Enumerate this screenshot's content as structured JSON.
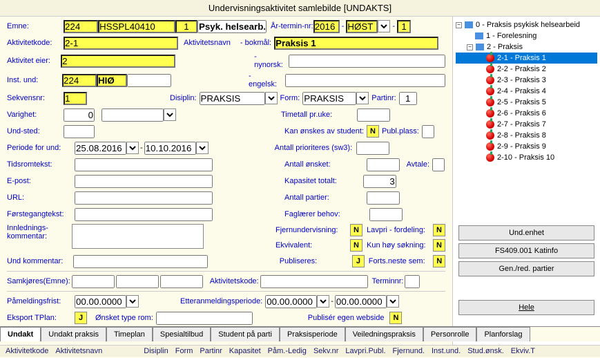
{
  "title": "Undervisningsaktivitet samlebilde   [UNDAKTS]",
  "labels": {
    "emne": "Emne:",
    "arTerminNr": "År-termin-nr:",
    "aktivitetkode": "Aktivitetkode:",
    "aktivitetsnavn": "Aktivitetsnavn",
    "bokmal": "- bokmål:",
    "aktivitetEier": "Aktivitet eier:",
    "nynorsk": "- nynorsk:",
    "instUnd": "Inst. und:",
    "engelsk": "- engelsk:",
    "sekvensnr": "Sekvensnr:",
    "disiplin": "Disiplin:",
    "form": "Form:",
    "partinr": "Partinr:",
    "varighet": "Varighet:",
    "timetall": "Timetall pr.uke:",
    "undSted": "Und-sted:",
    "kanOnskes": "Kan ønskes av student:",
    "publPlass": "Publ.plass:",
    "periodeForUnd": "Periode for und:",
    "antallPrioriteres": "Antall prioriteres (sw3):",
    "tidsromtekst": "Tidsromtekst:",
    "antallOnsket": "Antall ønsket:",
    "avtale": "Avtale:",
    "epost": "E-post:",
    "kapasitetTotalt": "Kapasitet totalt:",
    "url": "URL:",
    "antallPartier": "Antall partier:",
    "forstegangtekst": "Førstegangtekst:",
    "faglarerBehov": "Faglærer behov:",
    "innlednings": "Innlednings-",
    "kommentar": "kommentar:",
    "fjernundervisning": "Fjernundervisning:",
    "lavpriFordeling": "Lavpri - fordeling:",
    "ekvivalent": "Ekvivalent:",
    "kunHoySokning": "Kun høy søkning:",
    "undKommentar": "Und kommentar:",
    "publiseres": "Publiseres:",
    "fortsNesteSem": "Forts.neste sem:",
    "samkjores": "Samkjøres(Emne):",
    "aktivitetskode2": "Aktivitetskode:",
    "terminnr": "Terminnr:",
    "pameldingsfrist": "Påmeldingsfrist:",
    "etteranmeldingsperiode": "Etteranmeldingsperiode:",
    "eksportTPlan": "Eksport TPlan:",
    "onsketTypeRom": "Ønsket type rom:",
    "publiserEgenWebside": "Publisér egen webside"
  },
  "values": {
    "emne1": "224",
    "emne2": "HSSPL40410",
    "emne3": "1",
    "emne4": "Psyk. helsearb.",
    "ar": "2016",
    "termin": "HØST",
    "terminNr": "1",
    "aktivitetkode": "2-1",
    "navnBokmal": "Praksis 1",
    "aktivitetEier": "2",
    "instUnd1": "224",
    "instUnd2": "HIØ",
    "sekvensnr": "1",
    "disiplin": "PRAKSIS",
    "form": "PRAKSIS",
    "partinr": "1",
    "varighet": "0",
    "kanOnskes": "N",
    "periodeStart": "25.08.2016",
    "periodeEnd": "10.10.2016",
    "kapasitetTotalt": "3",
    "fjernundervisning": "N",
    "lavpriFordeling": "N",
    "ekvivalent": "N",
    "kunHoySokning": "N",
    "publiseres": "J",
    "fortsNesteSem": "N",
    "pameldingsfrist": "00.00.0000",
    "etterStart": "00.00.0000",
    "etterEnd": "00.00.0000",
    "eksportTPlan": "J",
    "publiserEgenWebside": "N"
  },
  "buttons": {
    "undEnhet": "Und.enhet",
    "katinfo": "FS409.001 Katinfo",
    "genRed": "Gen./red. partier",
    "hele": "Hele"
  },
  "tabs": [
    "Undakt",
    "Undakt praksis",
    "Timeplan",
    "Spesialtilbud",
    "Student på parti",
    "Praksisperiode",
    "Veiledningspraksis",
    "Personrolle",
    "Planforslag"
  ],
  "colHeaders": [
    "Aktivitetkode",
    "Aktivitetsnavn",
    "Disiplin",
    "Form",
    "Partinr",
    "Kapasitet",
    "Påm.-Ledig",
    "Sekv.nr",
    "Lavpri.Publ.",
    "Fjernund.",
    "Inst.und.",
    "Stud.ønsk.",
    "Ekviv.T"
  ],
  "tree": {
    "root": "0 - Praksis psykisk helsearbeid",
    "n1": "1 - Forelesning",
    "n2": "2 - Praksis",
    "leaves": [
      "2-1 - Praksis 1",
      "2-2 - Praksis 2",
      "2-3 - Praksis 3",
      "2-4 - Praksis 4",
      "2-5 - Praksis 5",
      "2-6 - Praksis 6",
      "2-7 - Praksis 7",
      "2-8 - Praksis 8",
      "2-9 - Praksis 9",
      "2-10 - Praksis 10"
    ]
  }
}
